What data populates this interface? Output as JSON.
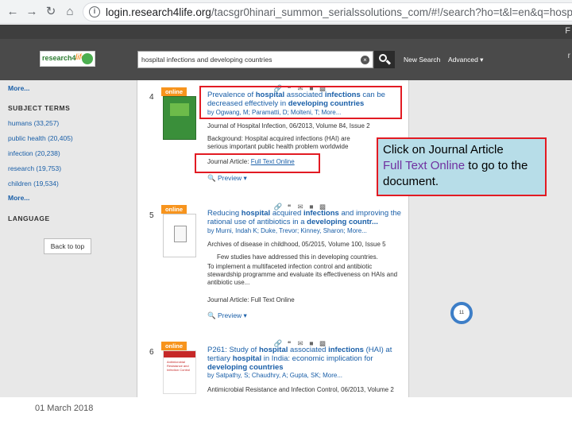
{
  "browser": {
    "url_host": "login.research4life.org",
    "url_path": "/tacsgr0hinari_summon_serialssolutions_com/#!/search?ho=t&l=en&q=hosp..."
  },
  "header": {
    "logo_text_1": "research4",
    "logo_text_2": "life",
    "search_value": "hospital infections and developing countries",
    "new_search": "New Search",
    "advanced": "Advanced ▾",
    "edge_f": "F",
    "edge_f2": "r"
  },
  "sidebar": {
    "more_top": "More...",
    "subject_terms_heading": "SUBJECT TERMS",
    "subject_terms": [
      "humans (33,257)",
      "public health (20,405)",
      "infection (20,238)",
      "research (19,753)",
      "children (19,534)"
    ],
    "more_bottom": "More...",
    "language_heading": "LANGUAGE",
    "back_to_top": "Back to top"
  },
  "results": [
    {
      "number": "4",
      "badge": "online",
      "title_parts": [
        "Prevalence of ",
        "hospital",
        " associated ",
        "infections",
        " can be decreased effectively in ",
        "developing countries"
      ],
      "authors": "by Ogwang, M; Paramatti, D; Molteni, T; More...",
      "source": "Journal of Hospital Infection, 06/2013, Volume 84, Issue 2",
      "snippet": "Background: Hospital acquired infections (HAI) are serious important public health problem worldwide",
      "access_type": "Journal Article:",
      "access_link": "Full Text Online",
      "preview": "Preview ▾"
    },
    {
      "number": "5",
      "badge": "online",
      "title_parts": [
        "Reducing ",
        "hospital",
        " acquired ",
        "infections",
        " and improving the rational use of antibiotics in a ",
        "developing countr..."
      ],
      "authors": "by Murni, Indah K; Duke, Trevor; Kinney, Sharon; More...",
      "source": "Archives of disease in childhood, 05/2015, Volume 100, Issue 5",
      "snippet_1": "Few studies have addressed this in developing countries.",
      "snippet_2": "To implement a multifaceted infection control and antibiotic stewardship programme and evaluate its effectiveness on HAIs and antibiotic use...",
      "access": "Journal Article: Full Text Online",
      "preview": "Preview ▾",
      "altmetric": "11"
    },
    {
      "number": "6",
      "badge": "online",
      "title_parts": [
        "P261: Study of ",
        "hospital",
        " associated ",
        "infections",
        " (HAI) at tertiary ",
        "hospital",
        " in India: economic implication for ",
        "developing countries"
      ],
      "authors": "by Satpathy, S; Chaudhry, A; Gupta, SK; More...",
      "source": "Antimicrobial Resistance and Infection Control, 06/2013, Volume 2",
      "cover_text": "Antimicrobial Resistance and Infection Control"
    }
  ],
  "callout": {
    "line_1": "Click on Journal Article",
    "highlight": "Full Text Online",
    "line_2": " to go to the document."
  },
  "footer": {
    "date": "01 March 2018"
  },
  "colors": {
    "annotation_red": "#e21b23",
    "callout_bg": "#b7dde8",
    "link_blue": "#1a5fa8",
    "online_orange": "#f7941d",
    "highlight_purple": "#7030a0"
  }
}
